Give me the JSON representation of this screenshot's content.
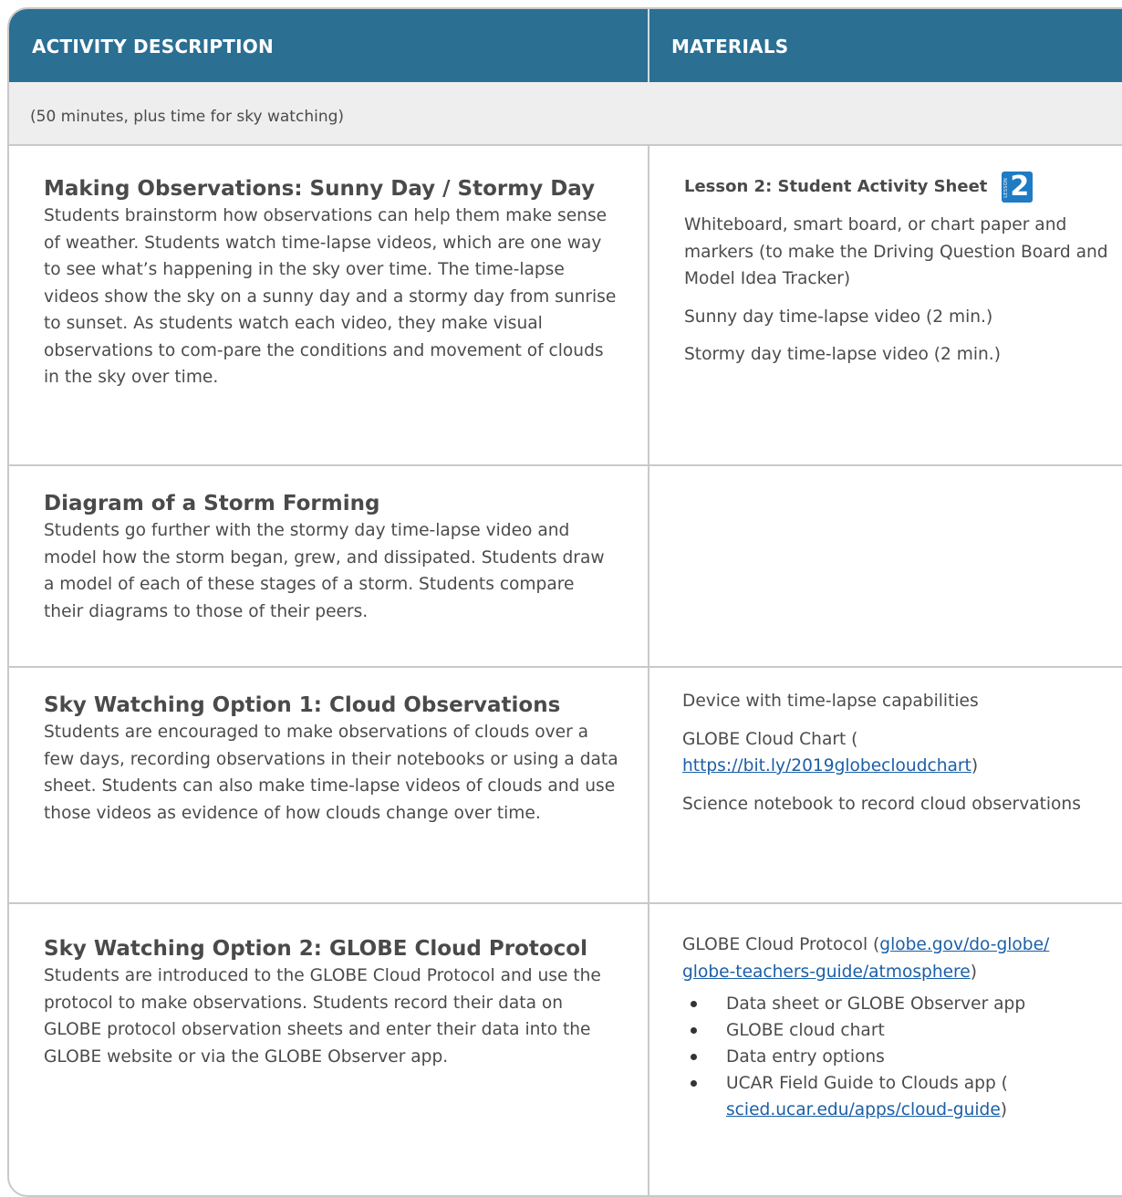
{
  "header": {
    "col1": "ACTIVITY DESCRIPTION",
    "col2": "MATERIALS"
  },
  "time_note": "(50 minutes, plus time for sky watching)",
  "rows": [
    {
      "title": "Making Observations: Sunny Day / Stormy Day",
      "description": "Students brainstorm how observations can help them make sense of weather. Students watch time-lapse videos, which are one way to see what’s happening in the sky over time. The time-lapse videos show the sky on a sunny day and a stormy day from sunrise to sunset. As students watch each video, they make visual observations to com-pare the conditions and movement of clouds in the sky over time.",
      "materials_heading": "Lesson 2: Student Activity Sheet",
      "badge_small": "LESSON",
      "badge_number": "2",
      "materials": [
        "Whiteboard, smart board, or chart paper and markers (to make the Driving Question Board and Model Idea Tracker)",
        "Sunny day time-lapse video (2 min.)",
        "Stormy day time-lapse video (2 min.)"
      ]
    },
    {
      "title": "Diagram of a Storm Forming",
      "description": "Students go further with the stormy day time-lapse video and model how the storm began, grew, and dissipated. Students draw a model of each of these stages of a storm. Students compare their diagrams to those of their peers."
    },
    {
      "title": "Sky Watching Option 1: Cloud Observations",
      "description": "Students are encouraged to make observations of clouds over a few days, recording observations in their notebooks or using a data sheet. Students can also make time-lapse videos of clouds and use those videos as evidence of how clouds change over time.",
      "materials": {
        "device": "Device with time-lapse capabilities",
        "chart_prefix": "GLOBE Cloud Chart (",
        "chart_link": "https://bit.ly/2019globecloudchart",
        "chart_suffix": ")",
        "notebook": "Science notebook to record cloud observations"
      }
    },
    {
      "title": "Sky Watching Option 2: GLOBE Cloud Protocol",
      "description": "Students are introduced to the GLOBE Cloud Protocol and use the protocol to make observations. Students record their data on GLOBE protocol observation sheets and enter their data into the GLOBE website or via the GLOBE Observer app.",
      "materials": {
        "protocol_prefix": "GLOBE Cloud Protocol (",
        "protocol_link_1": "globe.gov/do-globe/",
        "protocol_link_2": "globe-teachers-guide/atmosphere",
        "protocol_suffix": ")",
        "list": [
          "Data sheet or GLOBE Observer app",
          "GLOBE cloud chart",
          "Data entry options"
        ],
        "ucar_prefix": "UCAR Field Guide to Clouds app (",
        "ucar_link": "scied.ucar.edu/apps/cloud-guide",
        "ucar_suffix": ")"
      }
    }
  ]
}
